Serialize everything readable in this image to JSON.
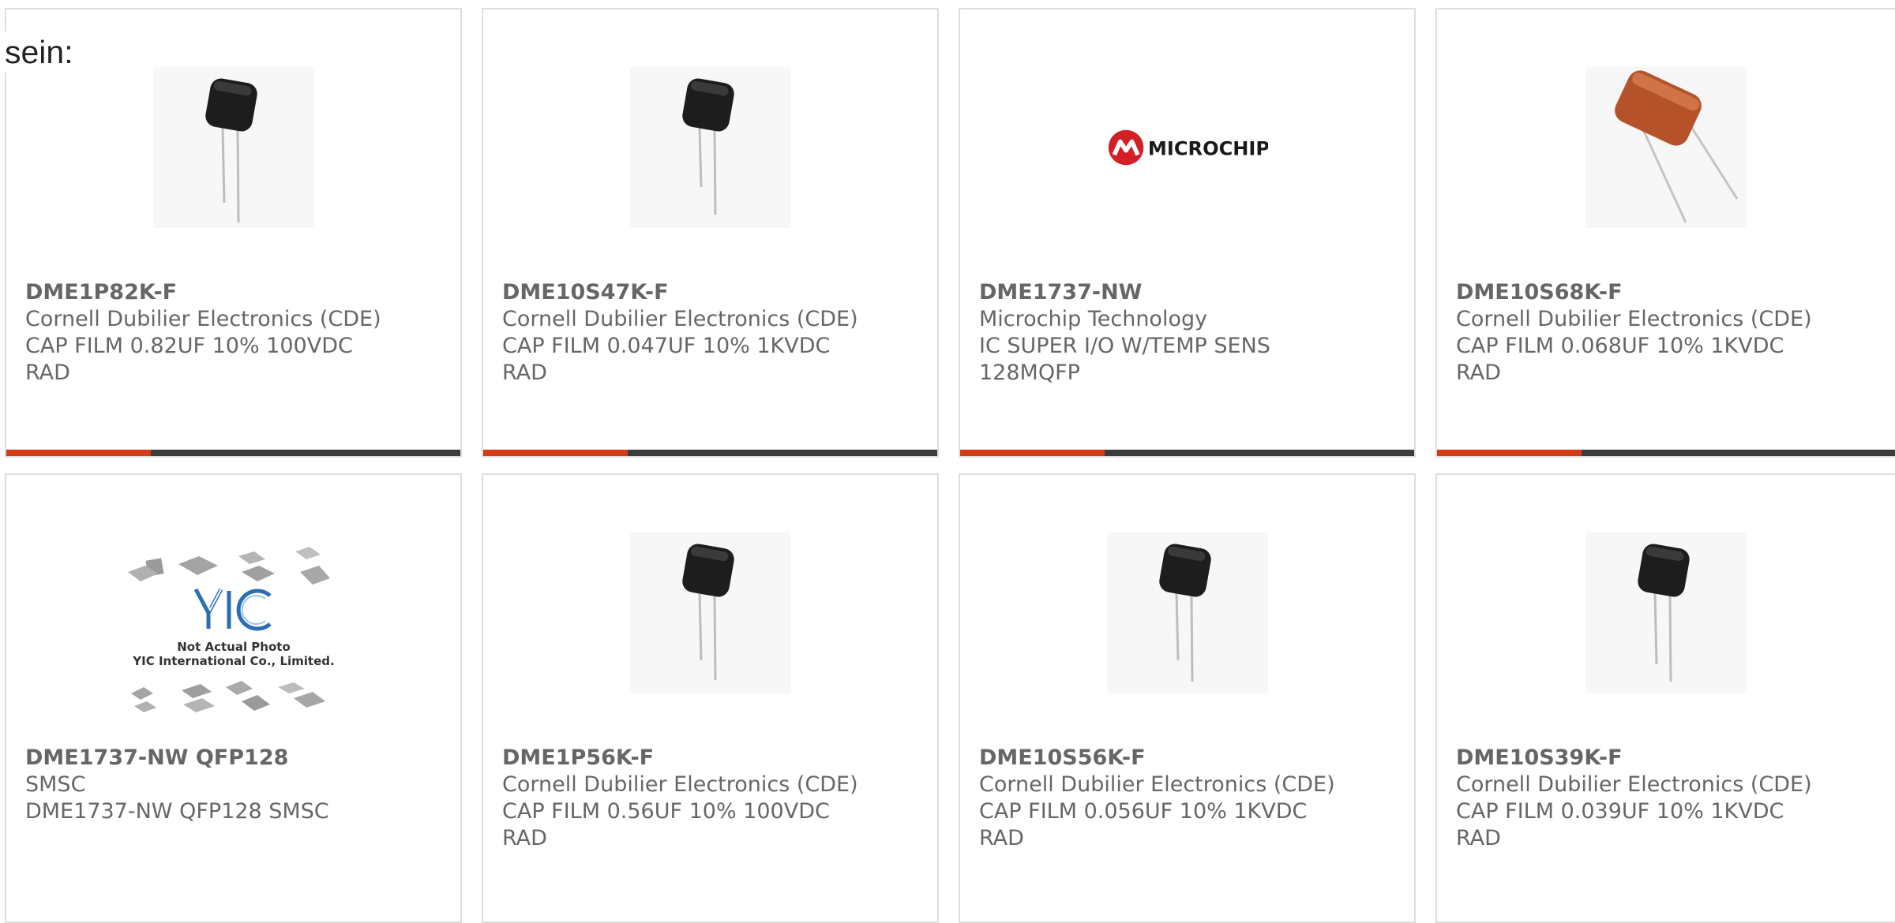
{
  "page": {
    "lead_text": "sein:"
  },
  "colors": {
    "accent": "#d63c14",
    "bar": "#3c3c3c",
    "text": "#666666",
    "border": "#dedede"
  },
  "products": [
    {
      "part_number": "DME1P82K-F",
      "manufacturer": "Cornell Dubilier Electronics (CDE)",
      "description_1": "CAP FILM 0.82UF 10% 100VDC",
      "description_2": "RAD",
      "image": "black-film-capacitor"
    },
    {
      "part_number": "DME10S47K-F",
      "manufacturer": "Cornell Dubilier Electronics (CDE)",
      "description_1": "CAP FILM 0.047UF 10% 1KVDC",
      "description_2": "RAD",
      "image": "black-film-capacitor"
    },
    {
      "part_number": "DME1737-NW",
      "manufacturer": "Microchip Technology",
      "description_1": "IC SUPER I/O W/TEMP SENS",
      "description_2": "128MQFP",
      "image": "microchip-logo",
      "logo_text": "MICROCHIP"
    },
    {
      "part_number": "DME10S68K-F",
      "manufacturer": "Cornell Dubilier Electronics (CDE)",
      "description_1": "CAP FILM 0.068UF 10% 1KVDC",
      "description_2": "RAD",
      "image": "orange-film-capacitor"
    },
    {
      "part_number": "DME1737-NW QFP128",
      "manufacturer": "SMSC",
      "description_1": "DME1737-NW QFP128 SMSC",
      "description_2": "",
      "image": "yic-placeholder",
      "placeholder_text_1": "Not Actual Photo",
      "placeholder_text_2": "YIC International Co., Limited.",
      "placeholder_logo": "YIC"
    },
    {
      "part_number": "DME1P56K-F",
      "manufacturer": "Cornell Dubilier Electronics (CDE)",
      "description_1": "CAP FILM 0.56UF 10% 100VDC",
      "description_2": "RAD",
      "image": "black-film-capacitor"
    },
    {
      "part_number": "DME10S56K-F",
      "manufacturer": "Cornell Dubilier Electronics (CDE)",
      "description_1": "CAP FILM 0.056UF 10% 1KVDC",
      "description_2": "RAD",
      "image": "black-film-capacitor"
    },
    {
      "part_number": "DME10S39K-F",
      "manufacturer": "Cornell Dubilier Electronics (CDE)",
      "description_1": "CAP FILM 0.039UF 10% 1KVDC",
      "description_2": "RAD",
      "image": "black-film-capacitor"
    }
  ]
}
